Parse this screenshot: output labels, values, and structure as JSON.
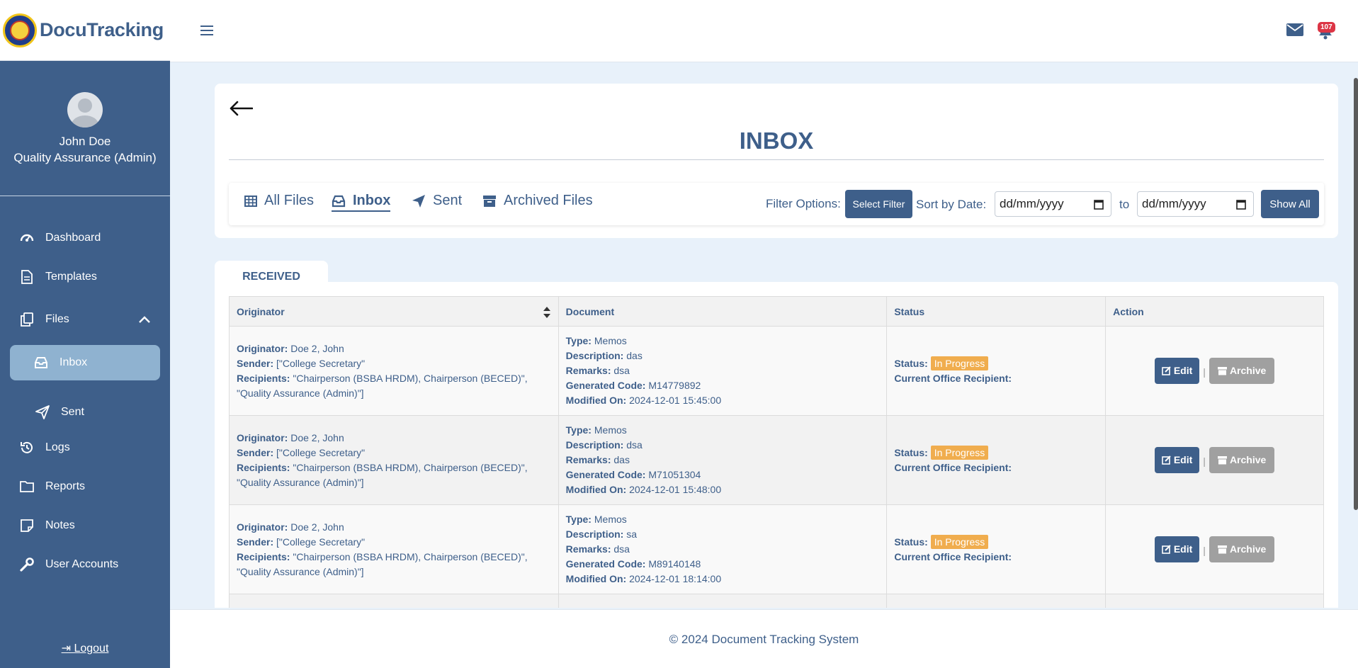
{
  "brand": {
    "name": "DocuTracking"
  },
  "profile": {
    "name": "John Doe",
    "role": "Quality Assurance (Admin)"
  },
  "nav": {
    "dashboard": "Dashboard",
    "templates": "Templates",
    "files": "Files",
    "inbox": "Inbox",
    "sent": "Sent",
    "logs": "Logs",
    "reports": "Reports",
    "notes": "Notes",
    "user_accounts": "User Accounts",
    "logout": "Logout"
  },
  "header": {
    "notification_count": "107"
  },
  "page": {
    "title": "INBOX"
  },
  "tabs": {
    "all_files": "All Files",
    "inbox": "Inbox",
    "sent": "Sent",
    "archived": "Archived Files"
  },
  "filter": {
    "label": "Filter Options:",
    "select_button": "Select Filter",
    "sort_label": "Sort by Date:",
    "date_from": "dd/mm/yyyy",
    "to_label": "to",
    "date_to": "dd/mm/yyyy",
    "show_all": "Show All"
  },
  "received_tab": "RECEIVED",
  "table": {
    "headers": {
      "originator": "Originator",
      "document": "Document",
      "status": "Status",
      "action": "Action"
    },
    "labels": {
      "originator": "Originator:",
      "sender": "Sender:",
      "recipients": "Recipients:",
      "type": "Type:",
      "description": "Description:",
      "remarks": "Remarks:",
      "code": "Generated Code:",
      "modified": "Modified On:",
      "status": "Status:",
      "current_office": "Current Office Recipient:",
      "edit": "Edit",
      "archive": "Archive",
      "separator": "|"
    },
    "rows": [
      {
        "originator": "Doe 2, John",
        "sender": "[\"College Secretary\"",
        "recipients": "\"Chairperson (BSBA HRDM), Chairperson (BECED)\", \"Quality Assurance (Admin)\"]",
        "type": "Memos",
        "description": "das",
        "remarks": "dsa",
        "code": "M14779892",
        "modified": "2024-12-01 15:45:00",
        "status": "In Progress"
      },
      {
        "originator": "Doe 2, John",
        "sender": "[\"College Secretary\"",
        "recipients": "\"Chairperson (BSBA HRDM), Chairperson (BECED)\", \"Quality Assurance (Admin)\"]",
        "type": "Memos",
        "description": "dsa",
        "remarks": "das",
        "code": "M71051304",
        "modified": "2024-12-01 15:48:00",
        "status": "In Progress"
      },
      {
        "originator": "Doe 2, John",
        "sender": "[\"College Secretary\"",
        "recipients": "\"Chairperson (BSBA HRDM), Chairperson (BECED)\", \"Quality Assurance (Admin)\"]",
        "type": "Memos",
        "description": "sa",
        "remarks": "dsa",
        "code": "M89140148",
        "modified": "2024-12-01 18:14:00",
        "status": "In Progress"
      }
    ]
  },
  "footer": "© 2024 Document Tracking System"
}
